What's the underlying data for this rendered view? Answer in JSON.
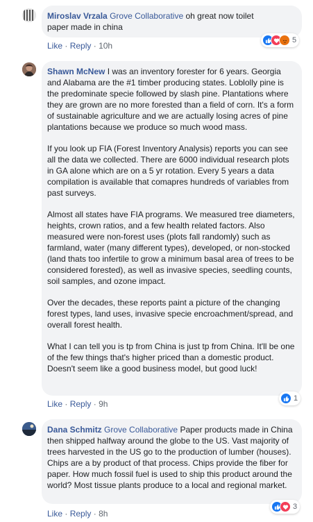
{
  "comments": [
    {
      "author": "Miroslav Vrzala",
      "group": "Grove Collaborative",
      "paragraphs": [
        "oh great now toilet paper made in china"
      ],
      "actions": {
        "like": "Like",
        "reply": "Reply",
        "time": "10h"
      },
      "reaction_count": "5",
      "reaction_icons": [
        "like-reaction-icon",
        "love-reaction-icon",
        "angry-reaction-icon"
      ]
    },
    {
      "author": "Shawn McNew",
      "group": "",
      "paragraphs": [
        "I was an inventory forester for 6 years. Georgia and Alabama are the #1 timber producing states. Loblolly pine is the predominate specie followed by slash pine. Plantations where they are grown are no more forested than a field of corn. It's a form of sustainable agriculture and we are actually losing acres of pine plantations because we produce so much wood mass.",
        "If you look up FIA (Forest Inventory Analysis) reports you can see all the data we collected. There are 6000 individual research plots in GA alone which are on a 5 yr rotation. Every 5 years a data compilation is available that comapres hundreds of variables from past surveys.",
        "Almost all states have FIA programs. We measured tree diameters, heights, crown ratios, and a few health related factors. Also measured were non-forest uses (plots fall randomly) such as farmland, water (many different types), developed, or non-stocked (land thats too infertile to grow a minimum basal area of trees to be considered forested), as well as invasive species, seedling counts, soil samples, and ozone impact.",
        "Over the decades, these reports paint a picture of the changing forest types, land uses, invasive specie encroachment/spread, and overall forest health.",
        "What I can tell you is tp from China is just tp from China. It'll be one of the few things that's higher priced than a domestic product. Doesn't seem like a good business model, but good luck!"
      ],
      "actions": {
        "like": "Like",
        "reply": "Reply",
        "time": "9h"
      },
      "reaction_count": "1",
      "reaction_icons": [
        "like-reaction-icon"
      ]
    },
    {
      "author": "Dana Schmitz",
      "group": "Grove Collaborative",
      "paragraphs": [
        "Paper products made in China then shipped halfway around the globe to the US. Vast majority of trees harvested in the US go to the production of lumber (houses). Chips are a by product of that process. Chips provide the fiber for paper. How much fossil fuel is used to ship this product around the world? Most tissue plants produce to a local and regional market."
      ],
      "actions": {
        "like": "Like",
        "reply": "Reply",
        "time": "8h"
      },
      "reaction_count": "3",
      "reaction_icons": [
        "like-reaction-icon",
        "love-reaction-icon"
      ]
    }
  ],
  "colors": {
    "link": "#385898",
    "bubble": "#f2f3f5",
    "like": "#1877f2",
    "love": "#f33e58",
    "angry": "#e9710f"
  }
}
